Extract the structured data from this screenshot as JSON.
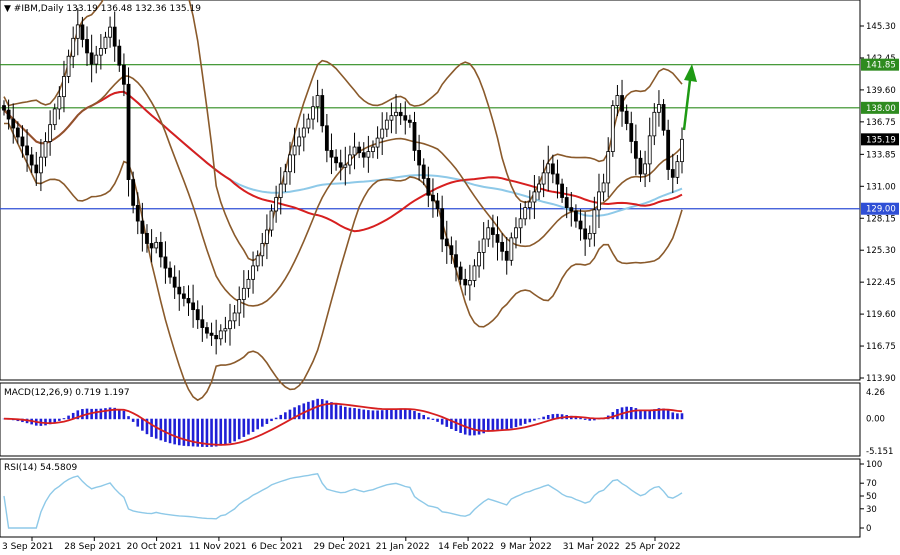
{
  "chart_data": [
    {
      "type": "candlestick",
      "symbol": "#IBM",
      "timeframe": "Daily",
      "header": "▼ #IBM,Daily  133.19 136.48 132.36 135.19",
      "ohlc_last": {
        "open": 133.19,
        "high": 136.48,
        "low": 132.36,
        "close": 135.19
      },
      "y_ticks": [
        145.3,
        142.45,
        139.6,
        136.75,
        133.85,
        131.0,
        128.15,
        125.3,
        122.45,
        119.6,
        116.75,
        113.9
      ],
      "y_tick_labels": [
        "145.30",
        "142.45",
        "139.60",
        "136.75",
        "133.85",
        "131.00",
        "128.15",
        "125.30",
        "122.45",
        "119.60",
        "116.75",
        "113.90"
      ],
      "ylim": [
        113.9,
        147.3
      ],
      "x_labels": [
        "3 Sep 2021",
        "28 Sep 2021",
        "20 Oct 2021",
        "11 Nov 2021",
        "6 Dec 2021",
        "29 Dec 2021",
        "21 Jan 2022",
        "14 Feb 2022",
        "9 Mar 2022",
        "31 Mar 2022",
        "25 Apr 2022"
      ],
      "levels": [
        {
          "value": 141.85,
          "label": "141.85",
          "color": "#2e8b1f"
        },
        {
          "value": 138.0,
          "label": "138.00",
          "color": "#2e8b1f"
        },
        {
          "value": 129.0,
          "label": "129.00",
          "color": "#2f4fd6"
        }
      ],
      "current_price": {
        "value": 135.19,
        "label": "135.19"
      },
      "closes": [
        137.8,
        137.0,
        136.2,
        135.4,
        134.6,
        133.8,
        132.9,
        132.2,
        133.6,
        135.0,
        136.5,
        137.9,
        139.0,
        140.8,
        142.6,
        144.2,
        145.4,
        144.1,
        142.9,
        141.9,
        142.7,
        143.3,
        144.3,
        145.2,
        143.5,
        141.8,
        140.1,
        131.6,
        129.3,
        127.9,
        126.8,
        125.9,
        125.5,
        126.0,
        124.7,
        123.7,
        122.9,
        122.0,
        121.4,
        121.0,
        120.6,
        120.0,
        119.1,
        118.4,
        117.9,
        117.7,
        117.4,
        118.1,
        118.3,
        119.0,
        119.7,
        120.9,
        121.9,
        122.7,
        123.9,
        124.8,
        125.9,
        127.1,
        128.8,
        130.0,
        131.2,
        132.3,
        133.8,
        134.6,
        135.4,
        136.2,
        137.0,
        138.1,
        139.1,
        136.4,
        134.2,
        133.6,
        133.1,
        132.7,
        132.9,
        133.8,
        134.5,
        134.0,
        133.6,
        134.1,
        134.5,
        135.3,
        136.1,
        136.9,
        137.3,
        137.6,
        137.3,
        136.9,
        136.7,
        134.2,
        132.9,
        131.7,
        130.2,
        129.7,
        129.0,
        126.3,
        125.7,
        124.9,
        123.8,
        122.7,
        122.2,
        122.6,
        123.9,
        125.1,
        126.3,
        127.3,
        126.7,
        126.0,
        125.2,
        124.4,
        126.4,
        127.3,
        128.1,
        129.1,
        129.6,
        130.5,
        131.2,
        132.2,
        133.0,
        132.1,
        131.2,
        130.0,
        129.1,
        128.8,
        127.9,
        127.2,
        126.3,
        126.8,
        128.9,
        130.5,
        131.3,
        134.1,
        138.2,
        139.1,
        137.7,
        136.6,
        135.0,
        133.5,
        132.1,
        133.0,
        135.5,
        137.6,
        138.3,
        136.0,
        132.5,
        131.8,
        133.2,
        135.19
      ],
      "series": [
        {
          "name": "MA",
          "color": "#d71f1f"
        },
        {
          "name": "MA",
          "color": "#8ec9e8"
        },
        {
          "name": "Bollinger Bands",
          "color": "#8a5a2b"
        }
      ]
    },
    {
      "type": "bar",
      "name": "MACD(12,26,9)",
      "header": "MACD(12,26,9) 0.719 1.197",
      "macd": 0.719,
      "signal": 1.197,
      "y_tick_labels": [
        "4.26",
        "0.00",
        "-5.151"
      ],
      "ylim": [
        -5.151,
        4.26
      ],
      "histogram_color": "#1f1fd6",
      "signal_color": "#d71f1f"
    },
    {
      "type": "line",
      "name": "RSI(14)",
      "header": "RSI(14) 54.5809",
      "value": 54.5809,
      "y_tick_labels": [
        "100",
        "70",
        "50",
        "30",
        "0"
      ],
      "ylim": [
        0,
        100
      ],
      "color": "#8ec9e8"
    }
  ]
}
